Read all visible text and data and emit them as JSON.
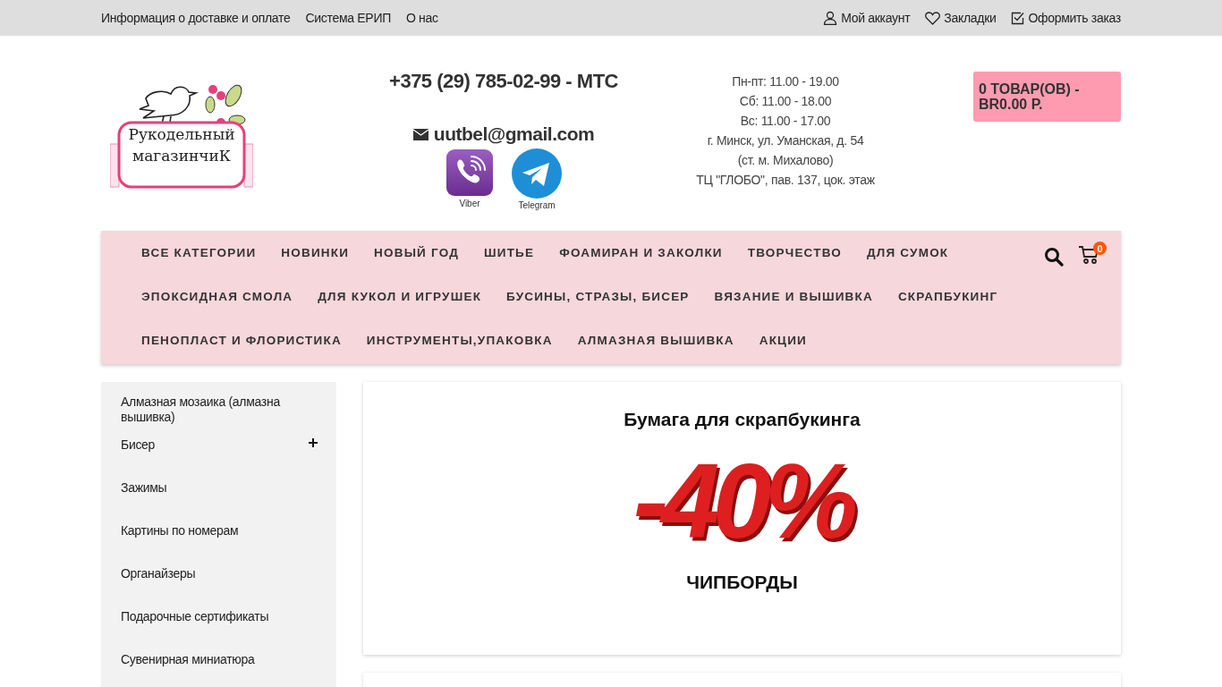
{
  "top_bar": {
    "links": [
      "Информация о доставке и оплате",
      "Система ЕРИП",
      "О нас"
    ],
    "account_links": [
      {
        "kind": "user",
        "label": "Мой аккаунт"
      },
      {
        "kind": "heart",
        "label": "Закладки"
      },
      {
        "kind": "check",
        "label": "Оформить заказ"
      }
    ]
  },
  "header": {
    "logo": {
      "line_1": "Рукодельный",
      "line_2": "магазинчиК"
    },
    "phone": "+375 (29) 785-02-99 - МТС",
    "email": "uutbel@gmail.com",
    "messengers": [
      {
        "kind": "viber",
        "label": "Viber"
      },
      {
        "kind": "telegram",
        "label": "Telegram"
      }
    ],
    "hours": [
      "Пн-пт: 11.00 - 19.00",
      "Сб: 11.00 - 18.00",
      "Вс: 11.00 - 17.00",
      "г. Минск, ул. Уманская, д. 54",
      "(ст. м. Михалово)",
      "ТЦ \"ГЛОБО\", пав. 137, цок. этаж"
    ],
    "cart_button": "0 ТОВАР(ОВ) - BR0.00 Р."
  },
  "menu": {
    "items": [
      "ВСЕ КАТЕГОРИИ",
      "НОВИНКИ",
      "НОВЫЙ ГОД",
      "ШИТЬЕ",
      "ФОАМИРАН И ЗАКОЛКИ",
      "ТВОРЧЕСТВО",
      "ДЛЯ СУМОК",
      "ЭПОКСИДНАЯ СМОЛА",
      "ДЛЯ КУКОЛ И ИГРУШЕК",
      "БУСИНЫ, СТРАЗЫ, БИСЕР",
      "ВЯЗАНИЕ И ВЫШИВКА",
      "СКРАПБУКИНГ",
      "ПЕНОПЛАСТ И ФЛОРИСТИКА",
      "ИНСТРУМЕНТЫ,УПАКОВКА",
      "АЛМАЗНАЯ ВЫШИВКА",
      "АКЦИИ"
    ],
    "cart_count": "0"
  },
  "sidebar": {
    "items": [
      {
        "lines": [
          "Алмазная мозаика (алмазна",
          "вышивка)"
        ],
        "expandable": false
      },
      {
        "lines": [
          "Бисер"
        ],
        "expandable": true
      },
      {
        "lines": [
          "Зажимы"
        ],
        "expandable": false
      },
      {
        "lines": [
          "Картины по номерам"
        ],
        "expandable": false
      },
      {
        "lines": [
          "Органайзеры"
        ],
        "expandable": false
      },
      {
        "lines": [
          "Подарочные сертификаты"
        ],
        "expandable": false
      },
      {
        "lines": [
          "Сувенирная миниатюра"
        ],
        "expandable": false
      }
    ]
  },
  "banner": {
    "title": "Бумага для скрапбукинга",
    "discount": "-40%",
    "caption": "ЧИПБОРДЫ"
  }
}
